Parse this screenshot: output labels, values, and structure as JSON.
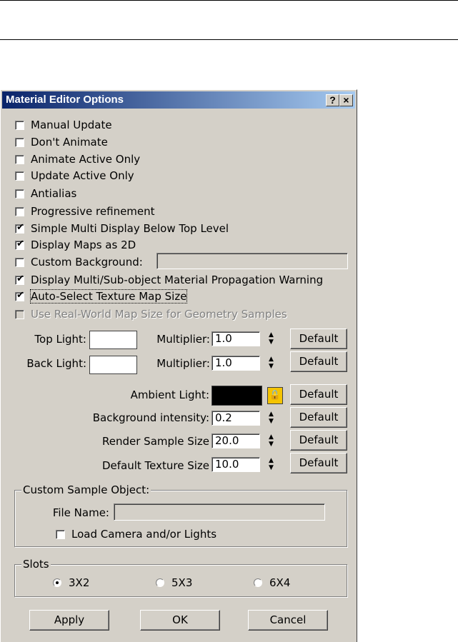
{
  "dialog": {
    "title": "Material Editor Options",
    "help_button": "?",
    "close_button": "×"
  },
  "options": [
    {
      "label": "Manual Update",
      "checked": false
    },
    {
      "label": "Don't Animate",
      "checked": false
    },
    {
      "label": "Animate Active Only",
      "checked": false
    },
    {
      "label": "Update Active Only",
      "checked": false
    },
    {
      "label": "Antialias",
      "checked": false
    },
    {
      "label": "Progressive refinement",
      "checked": false
    },
    {
      "label": "Simple Multi Display Below Top Level",
      "checked": true
    },
    {
      "label": "Display Maps as 2D",
      "checked": true
    },
    {
      "label": "Custom Background:",
      "checked": false
    },
    {
      "label": "Display Multi/Sub-object Material Propagation Warning",
      "checked": true
    },
    {
      "label": "Auto-Select Texture Map Size",
      "checked": true
    },
    {
      "label": "Use Real-World Map Size for Geometry Samples",
      "checked": false,
      "disabled": true
    }
  ],
  "lights": {
    "top_light_label": "Top Light:",
    "back_light_label": "Back Light:",
    "multiplier_label": "Multiplier:",
    "top_multiplier": "1.0",
    "back_multiplier": "1.0",
    "top_light_color": "#ffffff",
    "back_light_color": "#ffffff",
    "ambient_light_label": "Ambient Light:",
    "ambient_light_color": "#000000",
    "background_intensity_label": "Background intensity:",
    "background_intensity": "0.2",
    "render_sample_size_label": "Render Sample Size",
    "render_sample_size": "20.0",
    "default_texture_size_label": "Default Texture Size",
    "default_texture_size": "10.0",
    "default_button": "Default",
    "lock_icon": "lock-icon"
  },
  "custom_sample": {
    "group_label": "Custom Sample Object:",
    "file_name_label": "File Name:",
    "file_name_value": "",
    "load_camera_label": "Load Camera and/or Lights",
    "load_camera_checked": false
  },
  "slots": {
    "group_label": "Slots",
    "options": [
      "3X2",
      "5X3",
      "6X4"
    ],
    "selected": "3X2"
  },
  "footer": {
    "apply": "Apply",
    "ok": "OK",
    "cancel": "Cancel"
  }
}
